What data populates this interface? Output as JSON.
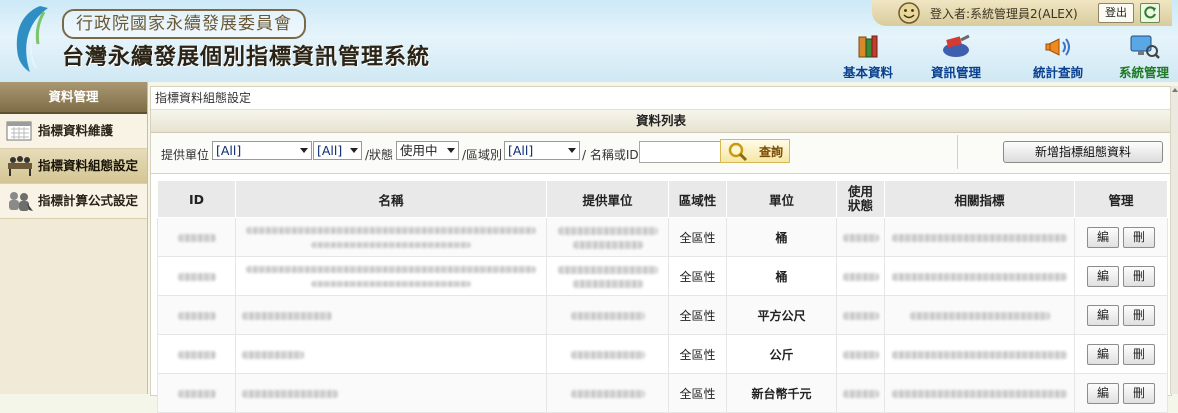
{
  "header": {
    "org_name": "行政院國家永續發展委員會",
    "system_title": "台灣永續發展個別指標資訊管理系統",
    "user_label": "登入者:系統管理員2(ALEX)",
    "logout_label": "登出",
    "nav": [
      {
        "label": "基本資料",
        "icon": "books-icon",
        "active": false
      },
      {
        "label": "資訊管理",
        "icon": "tools-icon",
        "active": false
      },
      {
        "label": "統計查詢",
        "icon": "megaphone-icon",
        "active": false
      },
      {
        "label": "系統管理",
        "icon": "monitor-search-icon",
        "active": true
      }
    ]
  },
  "sidebar": {
    "title": "資料管理",
    "items": [
      {
        "label": "指標資料維護",
        "icon": "calendar-icon",
        "active": false
      },
      {
        "label": "指標資料組態設定",
        "icon": "table-group-icon",
        "active": true
      },
      {
        "label": "指標計算公式設定",
        "icon": "users-icon",
        "active": false
      }
    ]
  },
  "main": {
    "breadcrumb": "指標資料組態設定",
    "section_title": "資料列表",
    "filters": {
      "provider_label": "提供單位",
      "provider_value": "[All]",
      "provider_sub_value": "[All]",
      "status_label": "/狀態",
      "status_value": "使用中",
      "region_label": "/區域別",
      "region_value": "[All]",
      "name_id_label": "/ 名稱或ID",
      "name_id_value": "",
      "query_label": "查詢",
      "add_label": "新增指標組態資料"
    },
    "table": {
      "headers": [
        "ID",
        "名稱",
        "提供單位",
        "區域性",
        "單位",
        "使用\n狀態",
        "相關指標",
        "管理"
      ],
      "rows": [
        {
          "region": "全區性",
          "unit": "桶"
        },
        {
          "region": "全區性",
          "unit": "桶"
        },
        {
          "region": "全區性",
          "unit": "平方公尺"
        },
        {
          "region": "全區性",
          "unit": "公斤"
        },
        {
          "region": "全區性",
          "unit": "新台幣千元"
        }
      ],
      "edit_label": "編",
      "delete_label": "刪"
    }
  },
  "colors": {
    "header_bg": "#cde9f7",
    "sidebar_head": "#8c7a52",
    "nav_text": "#0b3f8f",
    "nav_active": "#1f7a25"
  }
}
